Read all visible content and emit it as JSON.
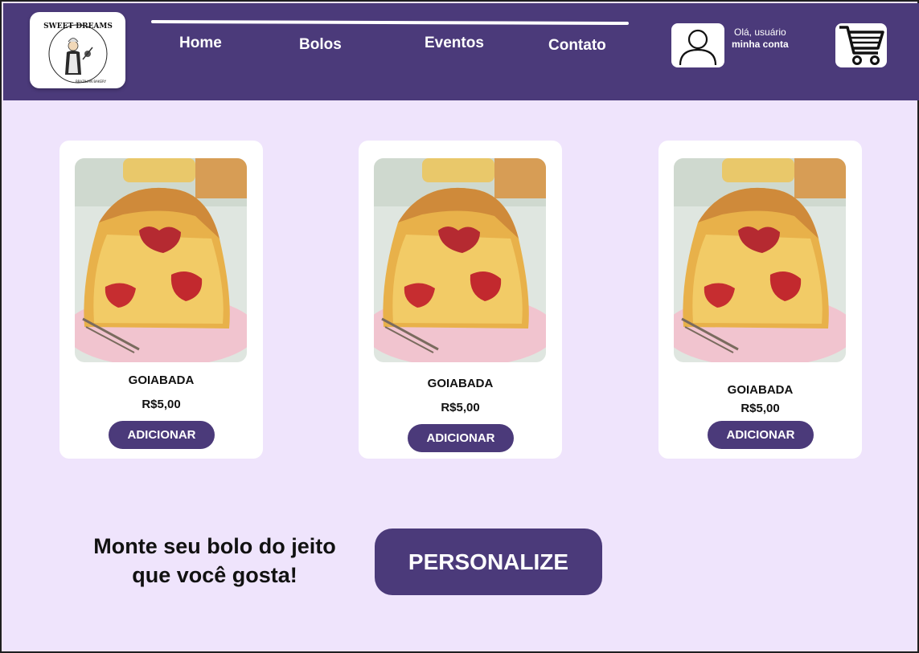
{
  "brand": {
    "logo_text": "SWEET DREAMS",
    "logo_subtext": "BRAZILIAN BAKERY"
  },
  "nav": {
    "items": [
      {
        "label": "Home"
      },
      {
        "label": "Bolos"
      },
      {
        "label": "Eventos"
      },
      {
        "label": "Contato"
      }
    ]
  },
  "user": {
    "greeting": "Olá, usuário",
    "account_label": "minha conta"
  },
  "icons": {
    "user": "user-icon",
    "cart": "cart-icon"
  },
  "products": [
    {
      "name": "GOIABADA",
      "price": "R$5,00",
      "button": "ADICIONAR"
    },
    {
      "name": "GOIABADA",
      "price": "R$5,00",
      "button": "ADICIONAR"
    },
    {
      "name": "GOIABADA",
      "price": "R$5,00",
      "button": "ADICIONAR"
    }
  ],
  "promo": {
    "line1": "Monte seu bolo do jeito",
    "line2": "que você gosta!",
    "button": "PERSONALIZE"
  },
  "colors": {
    "primary": "#4B3A7A",
    "background": "#EFE4FC",
    "card": "#FFFFFF"
  }
}
